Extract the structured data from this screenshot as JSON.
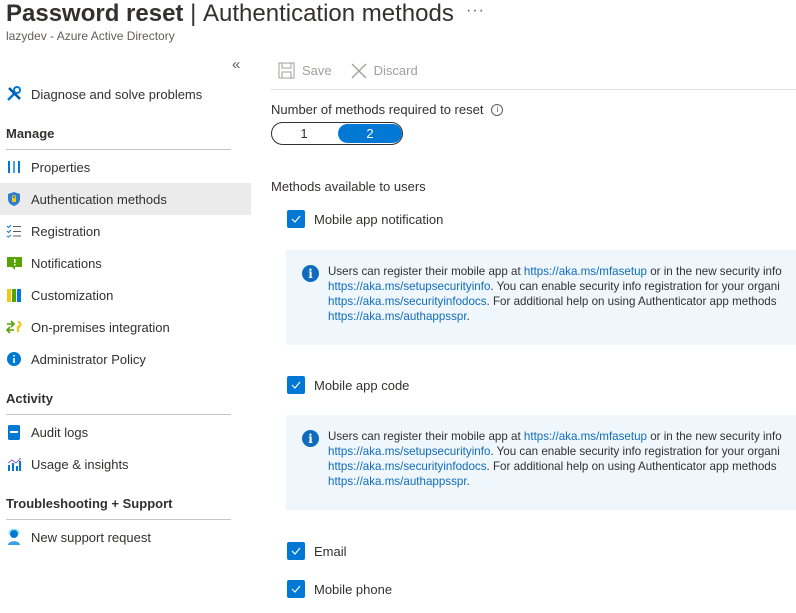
{
  "header": {
    "title_bold": "Password reset",
    "title_sep": " | ",
    "title_light": "Authentication methods",
    "more_label": "···",
    "subtitle": "lazydev - Azure Active Directory"
  },
  "sidebar": {
    "collapse_label": "«",
    "top_item": {
      "label": "Diagnose and solve problems",
      "icon": "wrench-icon"
    },
    "sections": [
      {
        "title": "Manage",
        "items": [
          {
            "label": "Properties",
            "icon": "properties-icon",
            "active": false
          },
          {
            "label": "Authentication methods",
            "icon": "shield-icon",
            "active": true
          },
          {
            "label": "Registration",
            "icon": "checklist-icon",
            "active": false
          },
          {
            "label": "Notifications",
            "icon": "notification-icon",
            "active": false
          },
          {
            "label": "Customization",
            "icon": "customization-icon",
            "active": false
          },
          {
            "label": "On-premises integration",
            "icon": "sync-icon",
            "active": false
          },
          {
            "label": "Administrator Policy",
            "icon": "info-icon",
            "active": false
          }
        ]
      },
      {
        "title": "Activity",
        "items": [
          {
            "label": "Audit logs",
            "icon": "audit-log-icon"
          },
          {
            "label": "Usage & insights",
            "icon": "insights-chart-icon"
          }
        ]
      },
      {
        "title": "Troubleshooting + Support",
        "items": [
          {
            "label": "New support request",
            "icon": "support-person-icon"
          }
        ]
      }
    ]
  },
  "toolbar": {
    "save_label": "Save",
    "discard_label": "Discard"
  },
  "main": {
    "methods_required_label": "Number of methods required to reset",
    "methods_required_options": [
      "1",
      "2"
    ],
    "methods_required_selected": "2",
    "methods_available_label": "Methods available to users",
    "methods": [
      {
        "label": "Mobile app notification",
        "checked": true
      },
      {
        "label": "Mobile app code",
        "checked": true
      },
      {
        "label": "Email",
        "checked": true
      },
      {
        "label": "Mobile phone",
        "checked": true
      }
    ],
    "info": {
      "line1_pre": "Users can register their mobile app at ",
      "link1": "https://aka.ms/mfasetup",
      "line1_post": " or in the new security info",
      "link2": "https://aka.ms/setupsecurityinfo",
      "line2_post": ". You can enable security info registration for your organi",
      "link3": "https://aka.ms/securityinfodocs",
      "line3_post": ". For additional help on using Authenticator app methods",
      "link4": "https://aka.ms/authappsspr",
      "line4_post": "."
    }
  },
  "colors": {
    "accent": "#0078d4",
    "info_bg": "#eff6fc",
    "link": "#0f6cbd",
    "active_bg": "#ebebeb"
  }
}
